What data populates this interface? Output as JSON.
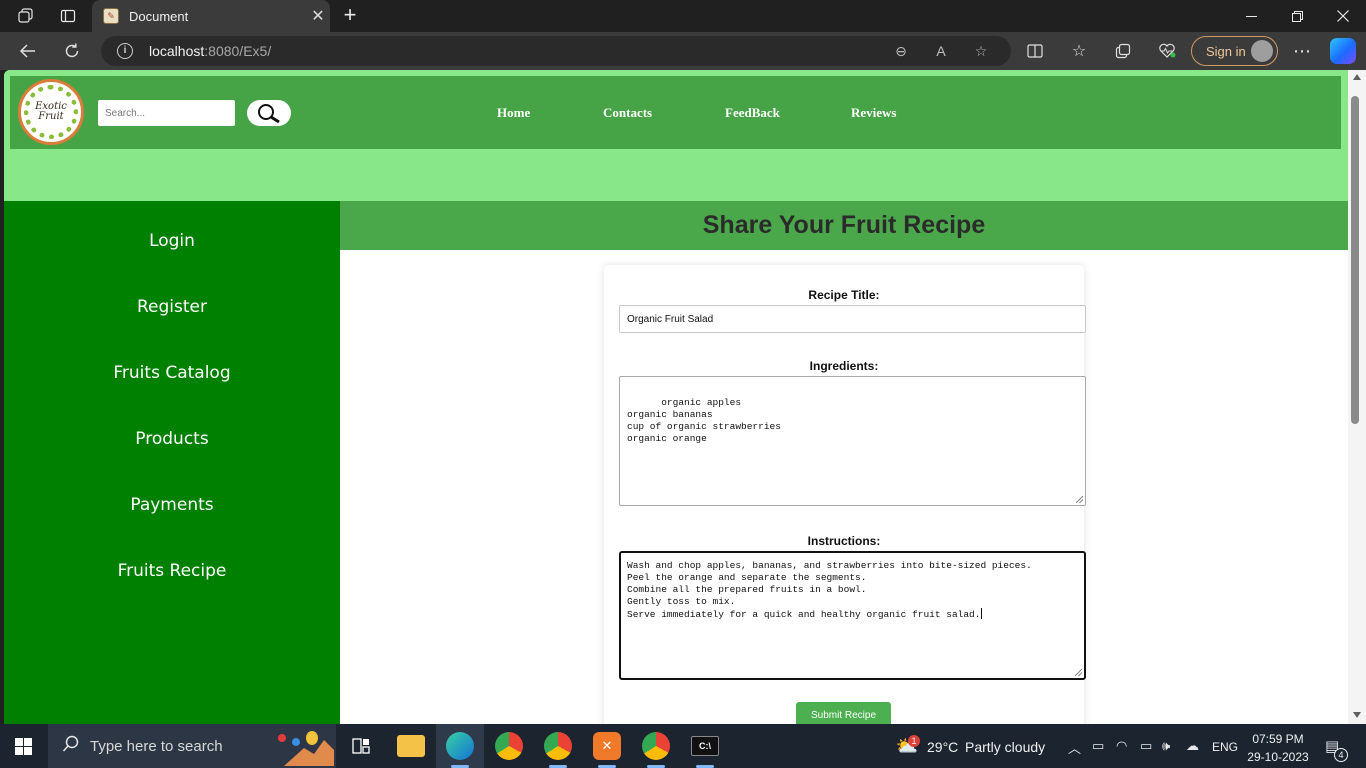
{
  "browser": {
    "tab_title": "Document",
    "url_host": "localhost",
    "url_path": ":8080/Ex5/",
    "signin_label": "Sign in"
  },
  "site": {
    "logo_text_1": "Exotic",
    "logo_text_2": "Fruit",
    "search_placeholder": "Search...",
    "nav": [
      "Home",
      "Contacts",
      "FeedBack",
      "Reviews"
    ],
    "sidebar": [
      "Login",
      "Register",
      "Fruits Catalog",
      "Products",
      "Payments",
      "Fruits Recipe"
    ],
    "page_title": "Share Your Fruit Recipe"
  },
  "form": {
    "title_label": "Recipe Title:",
    "title_value": "Organic Fruit Salad",
    "ingredients_label": "Ingredients:",
    "ingredients_value": "organic apples\norganic bananas\ncup of organic strawberries\norganic orange",
    "instructions_label": "Instructions:",
    "instructions_value": "Wash and chop apples, bananas, and strawberries into bite-sized pieces.\nPeel the orange and separate the segments.\nCombine all the prepared fruits in a bowl.\nGently toss to mix.\nServe immediately for a quick and healthy organic fruit salad.",
    "submit_label": "Submit Recipe"
  },
  "taskbar": {
    "search_placeholder": "Type here to search",
    "weather_temp": "29°C",
    "weather_desc": "Partly cloudy",
    "language": "ENG",
    "time": "07:59 PM",
    "date": "29-10-2023",
    "notification_count": "4",
    "weather_badge": "1"
  },
  "colors": {
    "header_bg": "#46a346",
    "header_band": "#88e788",
    "sidebar_bg": "#008000",
    "title_bar": "#4aa84a",
    "submit_bg": "#4caf50"
  }
}
